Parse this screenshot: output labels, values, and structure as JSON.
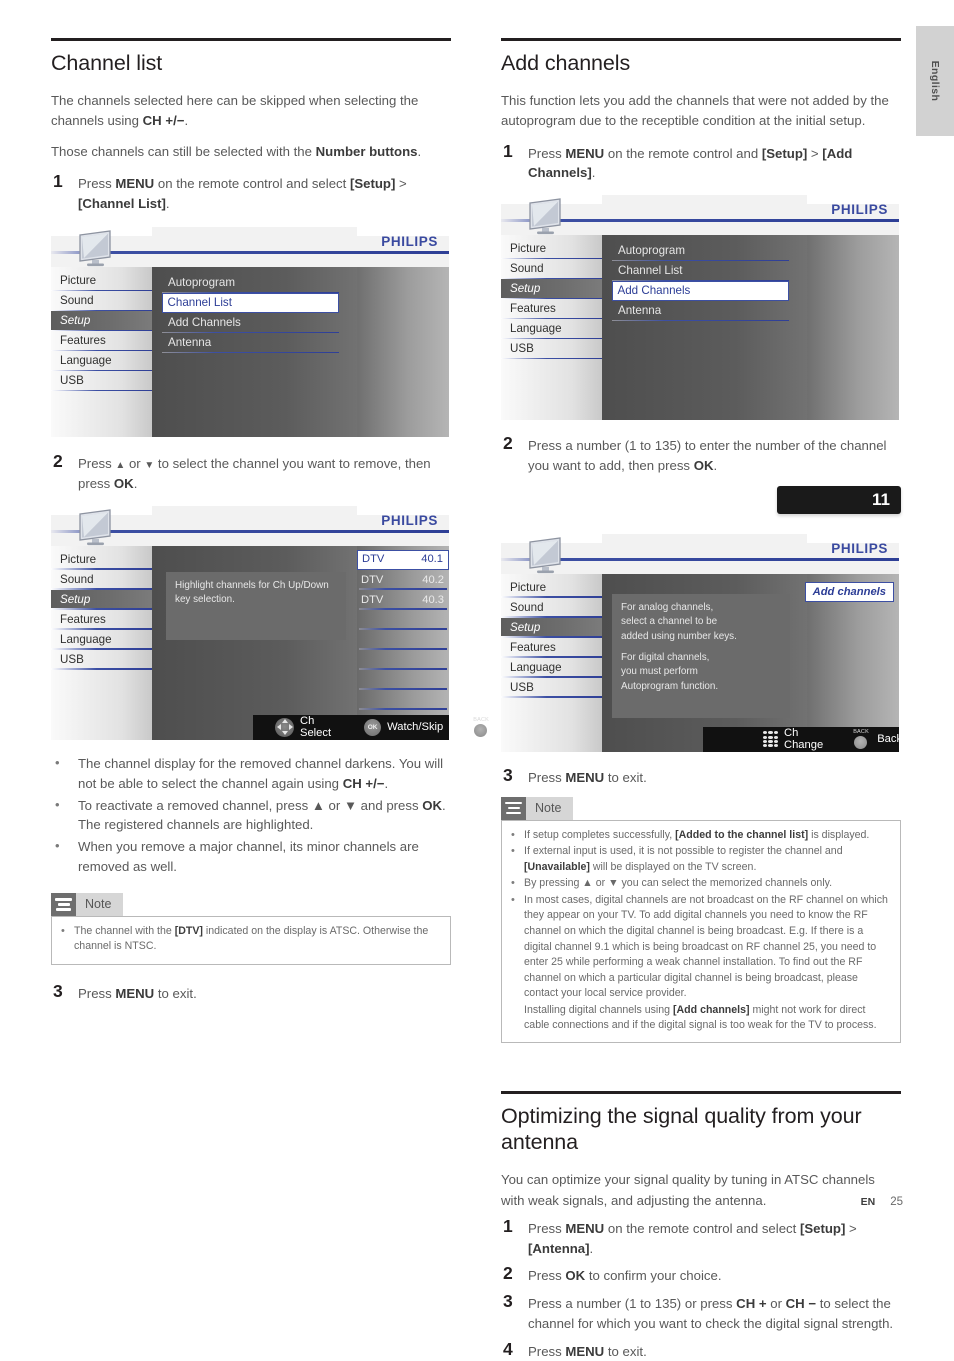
{
  "page": {
    "language_tab": "English",
    "footer_lang": "EN",
    "footer_page": "25"
  },
  "left_column": {
    "heading": "Channel list",
    "intro1_a": "The channels selected here can be skipped when selecting the channels using ",
    "intro1_b": "CH +/−",
    "intro1_c": ".",
    "intro2_a": "Those channels can still be selected with the ",
    "intro2_b": "Number buttons",
    "intro2_c": ".",
    "step1_num": "1",
    "step1_a": "Press ",
    "step1_menu": "MENU",
    "step1_b": " on the remote control and select ",
    "step1_setup": "[Setup]",
    "step1_c": " > ",
    "step1_chlist": "[Channel List]",
    "step1_d": ".",
    "step2_num": "2",
    "step2_a": "Press ",
    "step2_up": "▲",
    "step2_b": " or ",
    "step2_down": "▼",
    "step2_c": " to select the channel you want to remove, then press ",
    "step2_ok": "OK",
    "step2_d": ".",
    "bullets": [
      {
        "a": "The channel display for the removed channel darkens. You will not be able to select the channel again using ",
        "b": "CH +/−",
        "c": "."
      },
      {
        "a": "To reactivate a removed channel, press ▲ or ▼ and press ",
        "b": "OK",
        "c": ". The registered channels are highlighted."
      },
      {
        "a": "When you remove a major channel, its minor channels are removed as well.",
        "b": "",
        "c": ""
      }
    ],
    "note_label": "Note",
    "note_item_a": "The channel with the ",
    "note_item_b": "[DTV]",
    "note_item_c": " indicated on the display is ATSC. Otherwise the channel is NTSC.",
    "step3_num": "3",
    "step3_a": "Press ",
    "step3_menu": "MENU",
    "step3_b": " to exit."
  },
  "right_column": {
    "heading": "Add channels",
    "intro": "This function lets you add the channels that were not added by the autoprogram due to the receptible condition at the initial setup.",
    "step1_num": "1",
    "step1_a": "Press ",
    "step1_menu": "MENU",
    "step1_b": " on the remote control and ",
    "step1_setup": "[Setup]",
    "step1_c": " > ",
    "step1_add": "[Add Channels]",
    "step1_d": ".",
    "step2_num": "2",
    "step2_a": "Press a number (1 to 135) to enter the number of the channel you want to add, then press ",
    "step2_ok": "OK",
    "step2_b": ".",
    "channel_banner_value": "11",
    "step3_num": "3",
    "step3_a": "Press ",
    "step3_menu": "MENU",
    "step3_b": " to exit.",
    "note_label": "Note",
    "note_items": [
      {
        "a": "If setup completes successfully, ",
        "b": "[Added to the channel list]",
        "c": " is displayed."
      },
      {
        "a": "If external input is used, it is not possible to register the channel and ",
        "b": "[Unavailable]",
        "c": " will be displayed on the TV screen."
      },
      {
        "a": "By pressing ▲ or ▼ you can select the memorized channels only.",
        "b": "",
        "c": ""
      },
      {
        "a": "In most cases, digital channels are not broadcast on the RF channel on which they appear on your TV. To add digital channels you need to know the RF channel on which the digital channel is being broadcast. E.g. If there is a digital channel 9.1 which is being broadcast on RF channel 25, you need to enter 25 while performing a weak channel installation. To find out the RF channel on which a particular digital channel is being broadcast, please contact your local service provider.",
        "b": "",
        "c": ""
      }
    ],
    "note_last_a": "Installing digital channels using ",
    "note_last_b": "[Add channels]",
    "note_last_c": " might not work for direct cable connections and if the digital signal is too weak for the TV to process."
  },
  "optimizing": {
    "heading": "Optimizing the signal quality from your antenna",
    "intro": "You can optimize your signal quality by tuning in ATSC channels with weak signals, and adjusting the antenna.",
    "steps": [
      {
        "num": "1",
        "a": "Press ",
        "k1": "MENU",
        "b": " on the remote control and select ",
        "k2": "[Setup]",
        "c": " > ",
        "k3": "[Antenna]",
        "d": "."
      },
      {
        "num": "2",
        "a": "Press ",
        "k1": "OK",
        "b": " to confirm your choice.",
        "k2": "",
        "c": "",
        "k3": "",
        "d": ""
      },
      {
        "num": "3",
        "a": "Press a number (1 to 135) or press ",
        "k1": "CH +",
        "b": " or ",
        "k2": "CH −",
        "c": " to select the channel for which you want to check the digital signal strength.",
        "k3": "",
        "d": ""
      },
      {
        "num": "4",
        "a": "Press ",
        "k1": "MENU",
        "b": " to exit.",
        "k2": "",
        "c": "",
        "k3": "",
        "d": ""
      }
    ]
  },
  "osd": {
    "brand": "PHILIPS",
    "sidebar": [
      "Picture",
      "Sound",
      "Setup",
      "Features",
      "Language",
      "USB"
    ],
    "sidebar_selected": "Setup",
    "menu": [
      "Autoprogram",
      "Channel List",
      "Add Channels",
      "Antenna"
    ],
    "screen1_selected": "Channel List",
    "screen3_selected": "Add Channels",
    "screen2": {
      "tip": "Highlight channels for Ch Up/Down key selection.",
      "channels": [
        {
          "type": "DTV",
          "num": "40.1"
        },
        {
          "type": "DTV",
          "num": "40.2"
        },
        {
          "type": "DTV",
          "num": "40.3"
        }
      ],
      "empty_rows": 5,
      "keys": [
        {
          "icon": "dpad-icon",
          "label": "Ch Select"
        },
        {
          "icon": "ok-button-icon",
          "label": "Watch/Skip"
        },
        {
          "icon": "back-button-icon",
          "label": "Back"
        }
      ]
    },
    "screen4": {
      "tip_line1": "For analog channels,",
      "tip_line2": "select a channel to be",
      "tip_line3": "added using number keys.",
      "tip_line4": "For digital channels,",
      "tip_line5": "you must perform",
      "tip_line6": "Autoprogram function.",
      "badge": "Add channels",
      "keys": [
        {
          "icon": "numpad-icon",
          "label": "Ch Change"
        },
        {
          "icon": "back-button-icon",
          "label": "Back"
        }
      ]
    }
  },
  "colors": {
    "accent_blue": "#3c4fa3",
    "philips_blue": "#3a4aa0",
    "note_gray": "#6e6e6e",
    "heading_black": "#231f20"
  }
}
